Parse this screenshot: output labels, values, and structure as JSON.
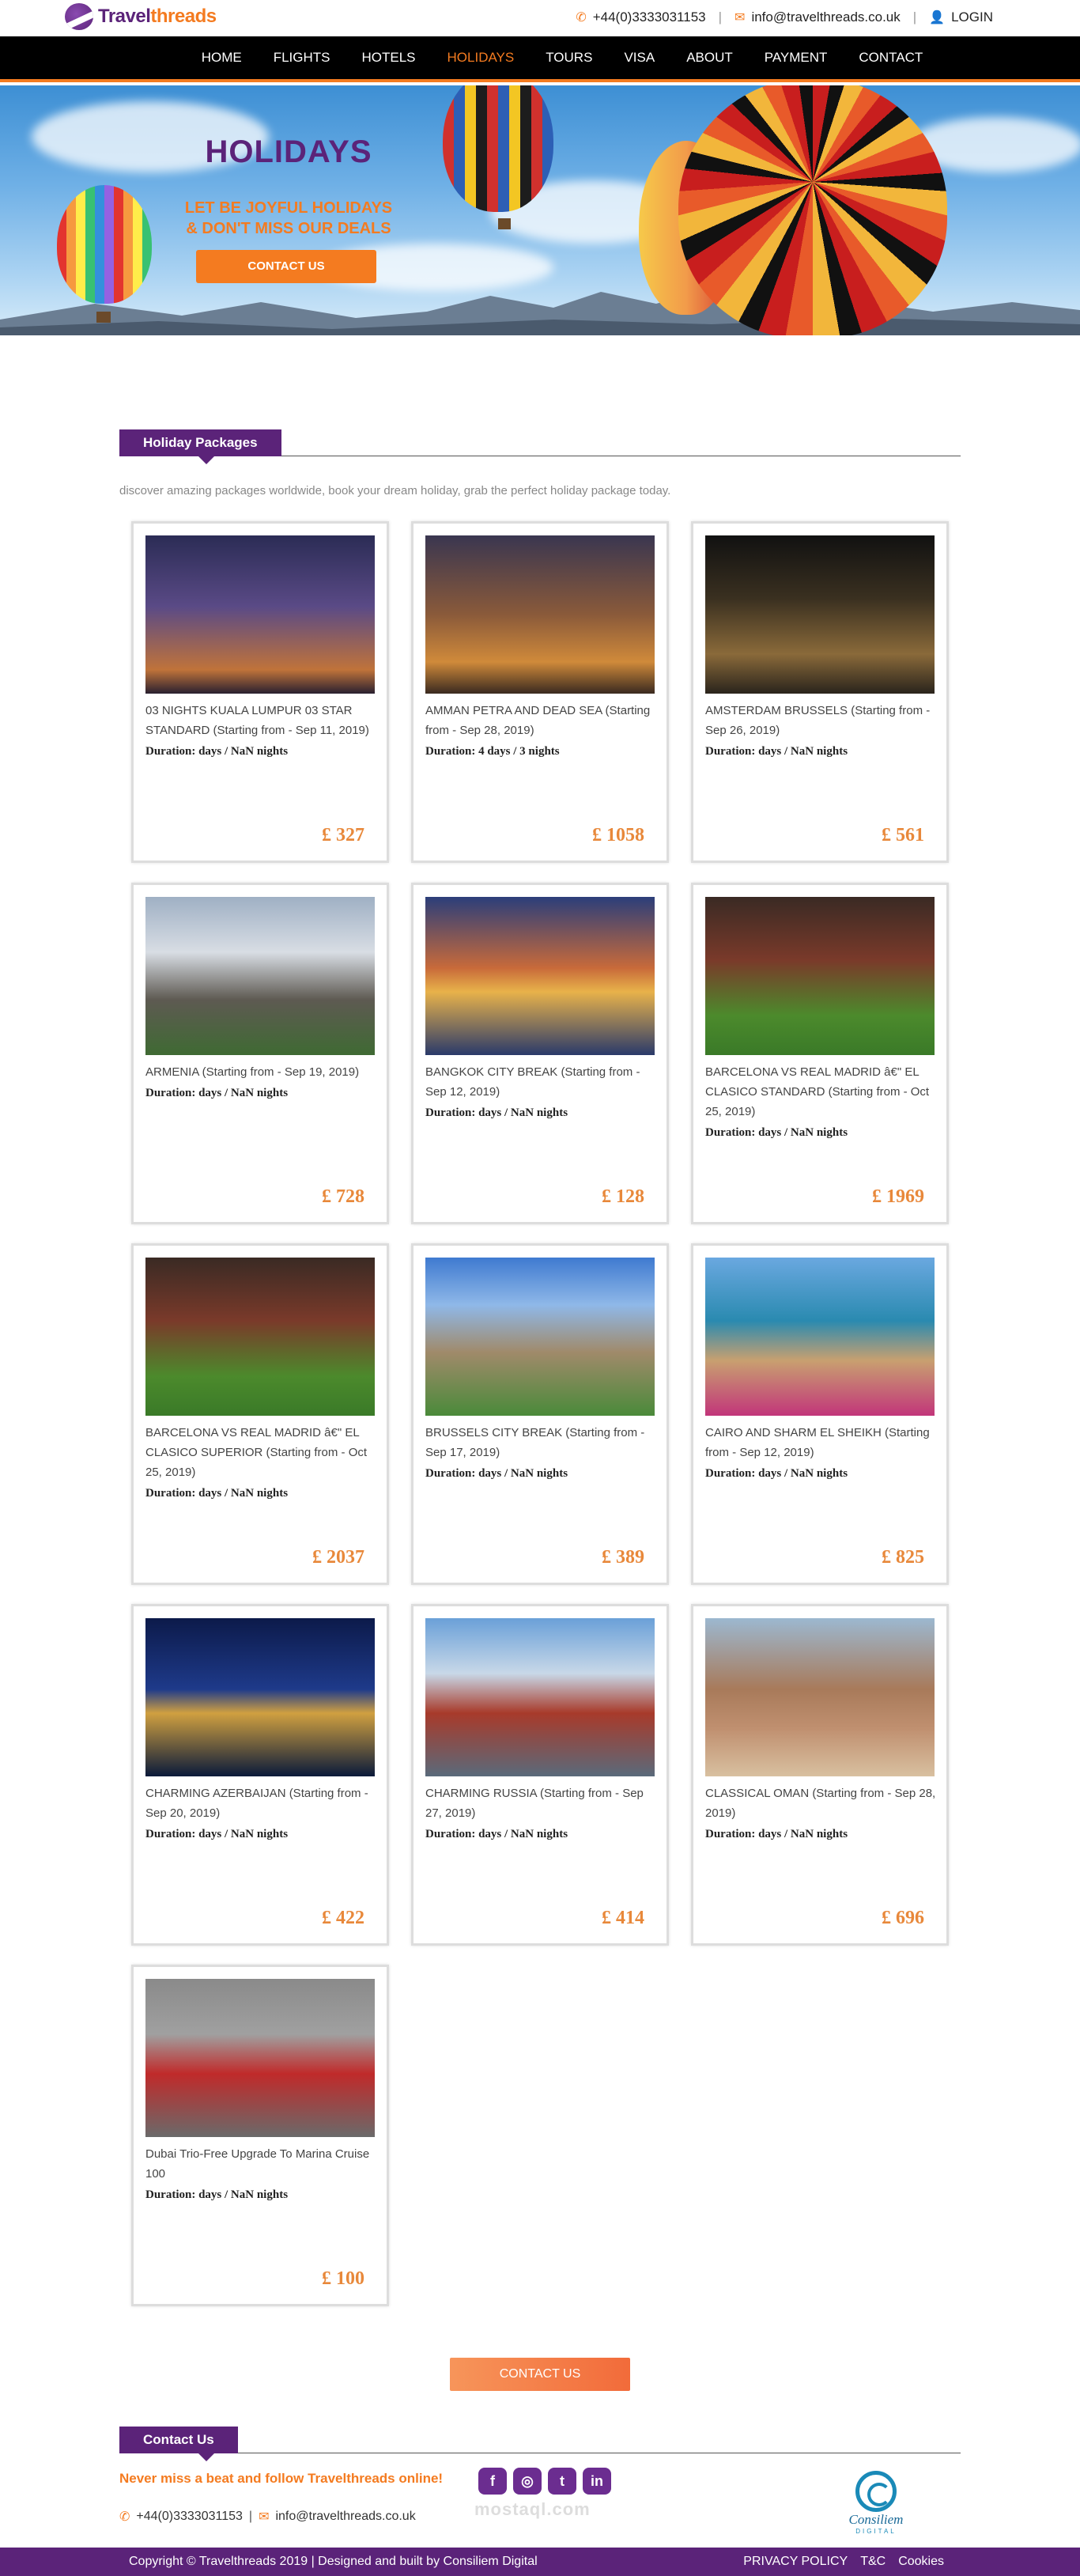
{
  "brand": {
    "part1": "Travel",
    "part2": "threads"
  },
  "topbar": {
    "phone": "+44(0)3333031153",
    "email": "info@travelthreads.co.uk",
    "login": "LOGIN",
    "phone_icon": "phone-icon",
    "email_icon": "envelope-icon",
    "user_icon": "user-icon"
  },
  "nav": {
    "items": [
      "HOME",
      "FLIGHTS",
      "HOTELS",
      "HOLIDAYS",
      "TOURS",
      "VISA",
      "ABOUT",
      "PAYMENT",
      "CONTACT"
    ],
    "active": "HOLIDAYS"
  },
  "hero": {
    "title": "HOLIDAYS",
    "subtitle_line1": "LET BE JOYFUL HOLIDAYS",
    "subtitle_line2": "& DON'T MISS OUR DEALS",
    "button": "CONTACT US"
  },
  "packages": {
    "heading": "Holiday Packages",
    "intro": "discover amazing packages worldwide, book your dream holiday, grab the perfect holiday package today.",
    "items": [
      {
        "title": "03 NIGHTS KUALA LUMPUR 03 STAR STANDARD (Starting from - Sep 11, 2019)",
        "duration": "Duration: days / NaN nights",
        "price": "£ 327"
      },
      {
        "title": "AMMAN PETRA AND DEAD SEA (Starting from - Sep 28, 2019)",
        "duration": "Duration: 4 days / 3 nights",
        "price": "£ 1058"
      },
      {
        "title": "AMSTERDAM BRUSSELS (Starting from - Sep 26, 2019)",
        "duration": "Duration: days / NaN nights",
        "price": "£ 561"
      },
      {
        "title": "ARMENIA (Starting from - Sep 19, 2019)",
        "duration": "Duration: days / NaN nights",
        "price": "£ 728"
      },
      {
        "title": "BANGKOK CITY BREAK (Starting from - Sep 12, 2019)",
        "duration": "Duration: days / NaN nights",
        "price": "£ 128"
      },
      {
        "title": "BARCELONA VS REAL MADRID â€\" EL CLASICO STANDARD (Starting from - Oct 25, 2019)",
        "duration": "Duration: days / NaN nights",
        "price": "£ 1969"
      },
      {
        "title": "BARCELONA VS REAL MADRID â€\" EL CLASICO SUPERIOR (Starting from - Oct 25, 2019)",
        "duration": "Duration: days / NaN nights",
        "price": "£ 2037"
      },
      {
        "title": "BRUSSELS CITY BREAK (Starting from - Sep 17, 2019)",
        "duration": "Duration: days / NaN nights",
        "price": "£ 389"
      },
      {
        "title": "CAIRO AND SHARM EL SHEIKH (Starting from - Sep 12, 2019)",
        "duration": "Duration: days / NaN nights",
        "price": "£ 825"
      },
      {
        "title": "CHARMING AZERBAIJAN (Starting from - Sep 20, 2019)",
        "duration": "Duration: days / NaN nights",
        "price": "£ 422"
      },
      {
        "title": "CHARMING RUSSIA (Starting from - Sep 27, 2019)",
        "duration": "Duration: days / NaN nights",
        "price": "£ 414"
      },
      {
        "title": "CLASSICAL OMAN (Starting from - Sep 28, 2019)",
        "duration": "Duration: days / NaN nights",
        "price": "£ 696"
      },
      {
        "title": "Dubai Trio-Free Upgrade To Marina Cruise 100",
        "duration": "Duration: days / NaN nights",
        "price": "£ 100"
      }
    ],
    "contact_button": "CONTACT US"
  },
  "footer": {
    "heading": "Contact Us",
    "promo": "Never miss a beat and follow Travelthreads online!",
    "socials": [
      "facebook-icon",
      "instagram-icon",
      "twitter-icon",
      "linkedin-icon"
    ],
    "social_glyphs": [
      "f",
      "◎",
      "t",
      "in"
    ],
    "phone": "+44(0)3333031153",
    "email": "info@travelthreads.co.uk",
    "watermark": "mostaql.com",
    "partner_name": "Consiliem",
    "partner_sub": "DIGITAL",
    "copyright": "Copyright © Travelthreads 2019 | Designed and built by Consiliem Digital",
    "links": [
      "PRIVACY POLICY",
      "T&C",
      "Cookies"
    ]
  },
  "colors": {
    "brand_purple": "#5b2379",
    "brand_orange": "#f47b20",
    "price": "#e8883a"
  }
}
